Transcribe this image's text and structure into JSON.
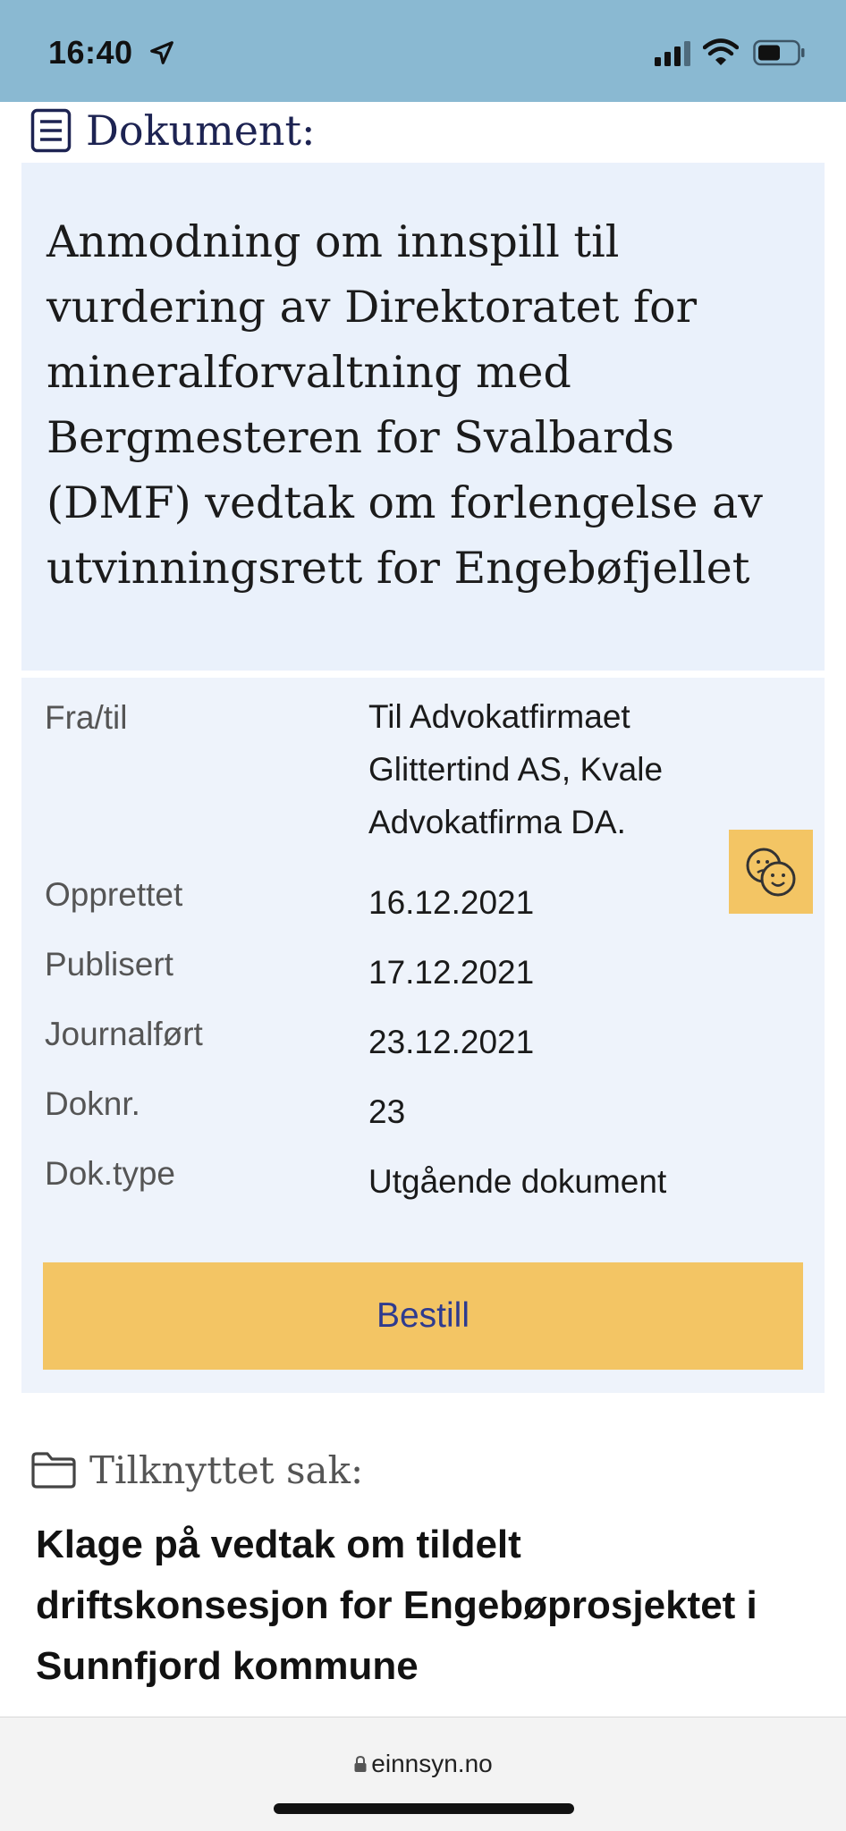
{
  "status_bar": {
    "time": "16:40",
    "icons": [
      "location-arrow-icon",
      "signal-bars-icon",
      "wifi-icon",
      "battery-icon"
    ]
  },
  "document": {
    "heading_label": "Dokument:",
    "heading_icon": "document-lines-icon",
    "title": "Anmodning om innspill til vurdering av Direktoratet for mineralforvaltning med Bergmesteren for Svalbards (DMF) vedtak om forlengelse av utvinningsrett for Engebøfjellet"
  },
  "meta": {
    "rows": [
      {
        "label": "Fra/til",
        "value": "Til Advokatfirmaet Glittertind AS, Kvale Advokatfirma DA."
      },
      {
        "label": "Opprettet",
        "value": "16.12.2021"
      },
      {
        "label": "Publisert",
        "value": "17.12.2021"
      },
      {
        "label": "Journalført",
        "value": "23.12.2021"
      },
      {
        "label": "Doknr.",
        "value": "23"
      },
      {
        "label": "Dok.type",
        "value": "Utgående dokument"
      }
    ]
  },
  "actions": {
    "order_label": "Bestill",
    "feedback_icon": "feedback-faces-icon"
  },
  "case": {
    "heading_label": "Tilknyttet sak:",
    "heading_icon": "folder-icon",
    "title": "Klage på vedtak om tildelt driftskonsesjon for Engebøprosjektet i Sunnfjord kommune"
  },
  "browser": {
    "url": "einnsyn.no"
  },
  "colors": {
    "status_bar": "#8ab9d2",
    "accent_yellow": "#f3c564",
    "panel_blue": "#eaf1fb",
    "button_text": "#2e3b8f"
  }
}
